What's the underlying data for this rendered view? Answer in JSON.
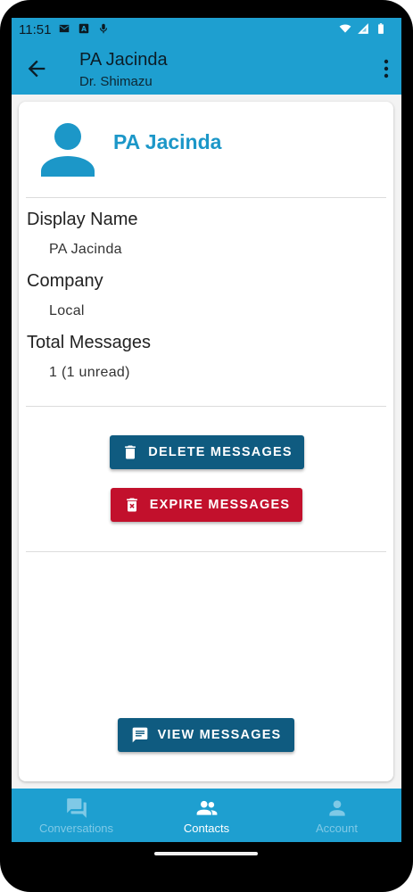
{
  "status_bar": {
    "time": "11:51",
    "left_icons": [
      "mail-icon",
      "a-badge-icon",
      "microphone-icon"
    ],
    "right_icons": [
      "wifi-icon",
      "signal-icon",
      "battery-icon"
    ]
  },
  "app_bar": {
    "title": "PA Jacinda",
    "subtitle": "Dr. Shimazu",
    "back_icon": "arrow-back-icon",
    "menu_icon": "more-vert-icon"
  },
  "contact": {
    "name": "PA Jacinda",
    "fields": [
      {
        "label": "Display Name",
        "value": "PA Jacinda"
      },
      {
        "label": "Company",
        "value": "Local"
      },
      {
        "label": "Total Messages",
        "value": "1 (1 unread)"
      }
    ]
  },
  "actions": {
    "delete_label": "DELETE MESSAGES",
    "expire_label": "EXPIRE MESSAGES",
    "view_label": "VIEW MESSAGES"
  },
  "bottom_nav": {
    "items": [
      {
        "label": "Conversations",
        "icon": "conversations-icon",
        "active": false
      },
      {
        "label": "Contacts",
        "icon": "contacts-icon",
        "active": true
      },
      {
        "label": "Account",
        "icon": "account-icon",
        "active": false
      }
    ]
  },
  "colors": {
    "primary": "#1e9fd0",
    "dark_button": "#0f5b80",
    "danger_button": "#c2102c",
    "accent_text": "#1c97c8"
  }
}
